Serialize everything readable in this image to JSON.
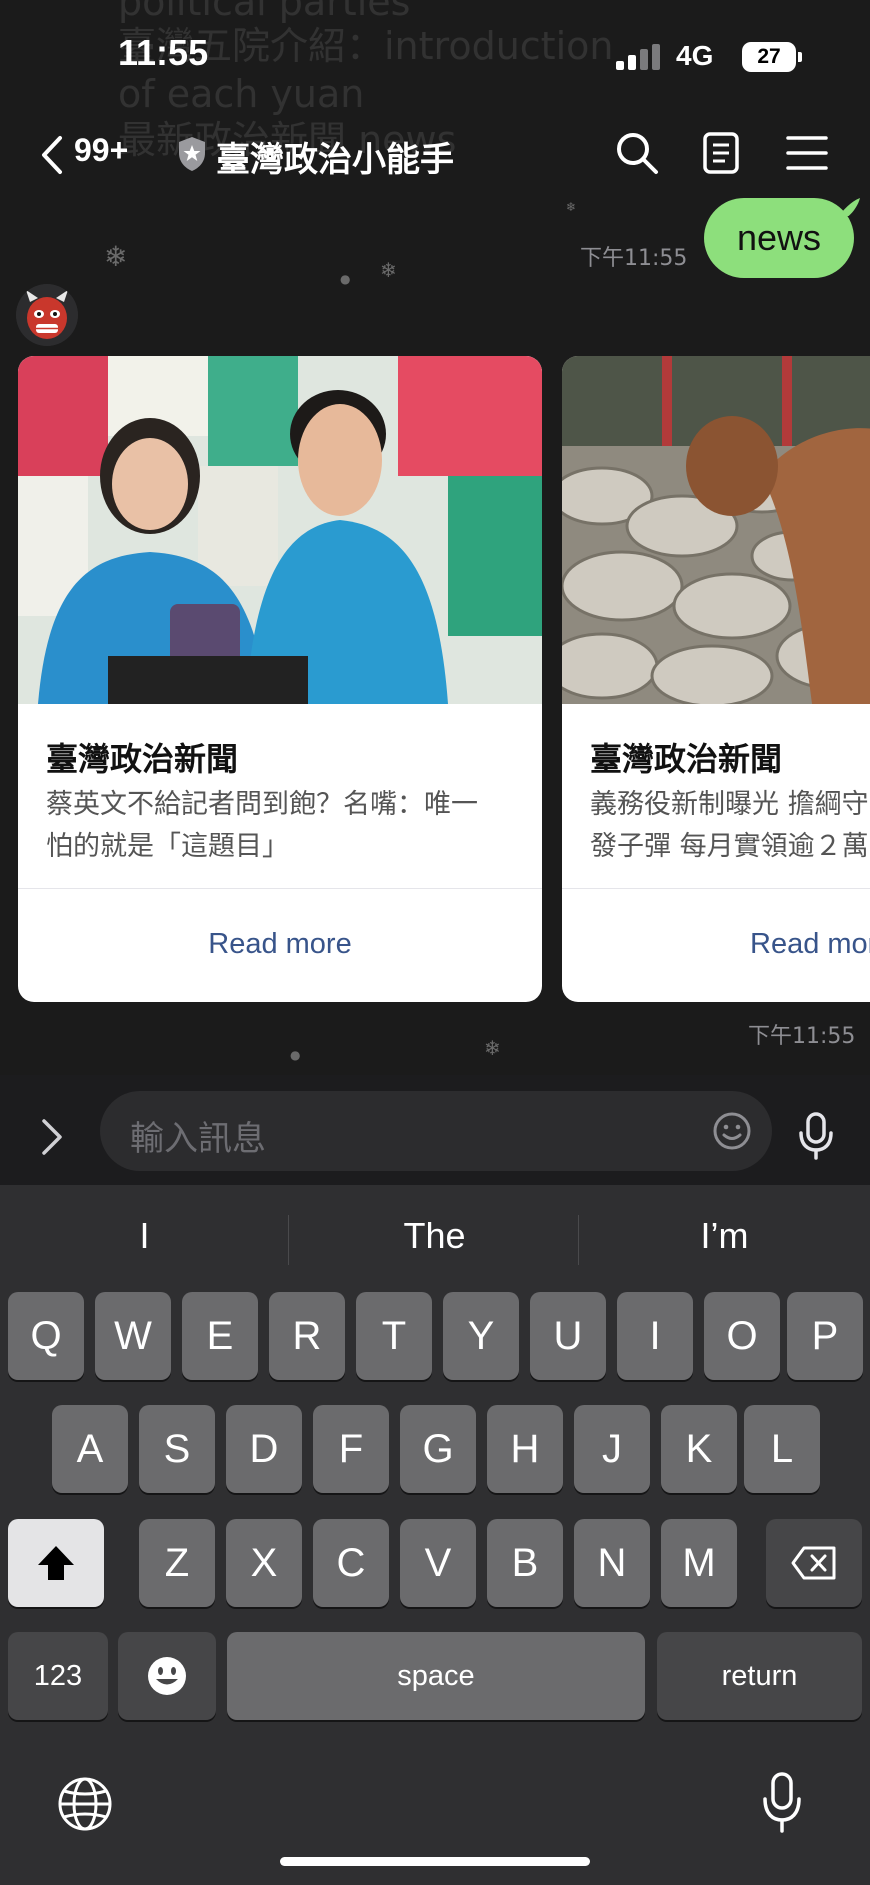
{
  "status_bar": {
    "time": "11:55",
    "network": "4G",
    "battery": "27"
  },
  "background_text": [
    "political parties",
    "臺灣五院介紹：introduction",
    "of each yuan",
    "最新政治新聞 news"
  ],
  "header": {
    "unread_count": "99+",
    "title": "臺灣政治小能手"
  },
  "messages": {
    "sent": {
      "text": "news",
      "time": "下午11:55"
    },
    "received_time": "下午11:55"
  },
  "cards": [
    {
      "title": "臺灣政治新聞",
      "desc_line1": "蔡英文不給記者問到飽？名嘴：唯一",
      "desc_line2": "怕的就是「這題目」",
      "link": "Read more"
    },
    {
      "title": "臺灣政治新聞",
      "desc_line1": "義務役新制曝光 擔綱守",
      "desc_line2": "發子彈 每月實領逾２萬",
      "link": "Read more"
    }
  ],
  "input": {
    "placeholder": "輸入訊息"
  },
  "keyboard": {
    "suggestions": [
      "I",
      "The",
      "I’m"
    ],
    "row1": [
      "Q",
      "W",
      "E",
      "R",
      "T",
      "Y",
      "U",
      "I",
      "O",
      "P"
    ],
    "row2": [
      "A",
      "S",
      "D",
      "F",
      "G",
      "H",
      "J",
      "K",
      "L"
    ],
    "row3": [
      "Z",
      "X",
      "C",
      "V",
      "B",
      "N",
      "M"
    ],
    "numbers": "123",
    "space": "space",
    "return": "return"
  },
  "colors": {
    "bubble": "#8ddf7c",
    "link": "#38548a",
    "background": "#1b1b1b"
  }
}
